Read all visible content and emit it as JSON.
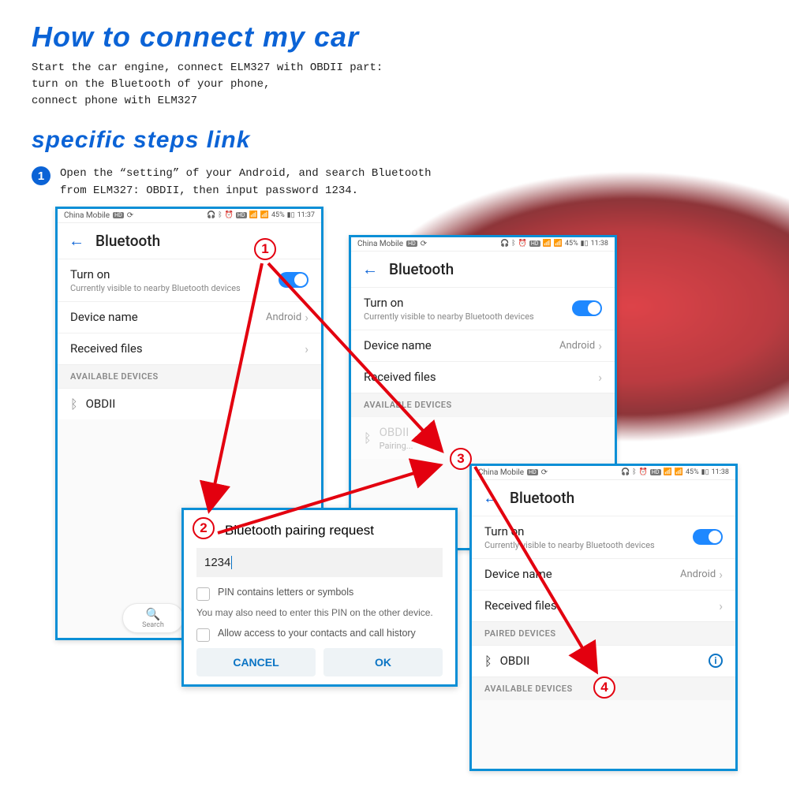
{
  "heading1": "How to connect my car",
  "intro_lines": [
    "Start the car engine, connect ELM327 with OBDII part:",
    "turn on the Bluetooth of your phone,",
    "connect phone with ELM327"
  ],
  "heading2": "specific steps link",
  "step1_bullet": "1",
  "step1_text_a": "Open the “setting” of your Android, and search Bluetooth",
  "step1_text_b": "from ELM327: OBDII, then input password 1234.",
  "statusbar": {
    "carrier": "China Mobile",
    "carrier_badge": "HD",
    "right_text": "45%",
    "time": "11:37",
    "time_b": "11:38"
  },
  "bt": {
    "title": "Bluetooth",
    "turn_on": "Turn on",
    "visible_sub": "Currently visible to nearby Bluetooth devices",
    "device_name": "Device name",
    "device_val": "Android",
    "received": "Received files",
    "avail_hdr": "AVAILABLE DEVICES",
    "paired_hdr": "PAIRED DEVICES",
    "obdii": "OBDII",
    "pairing": "Pairing..."
  },
  "dialog": {
    "title": "Bluetooth pairing request",
    "pin": "1234",
    "pin_letters": "PIN contains letters or symbols",
    "note": "You may also need to enter this PIN on the other device.",
    "allow": "Allow access to your contacts and call history",
    "cancel": "CANCEL",
    "ok": "OK"
  },
  "search_label": "Search",
  "markers": {
    "m1": "1",
    "m2": "2",
    "m3": "3",
    "m4": "4"
  }
}
